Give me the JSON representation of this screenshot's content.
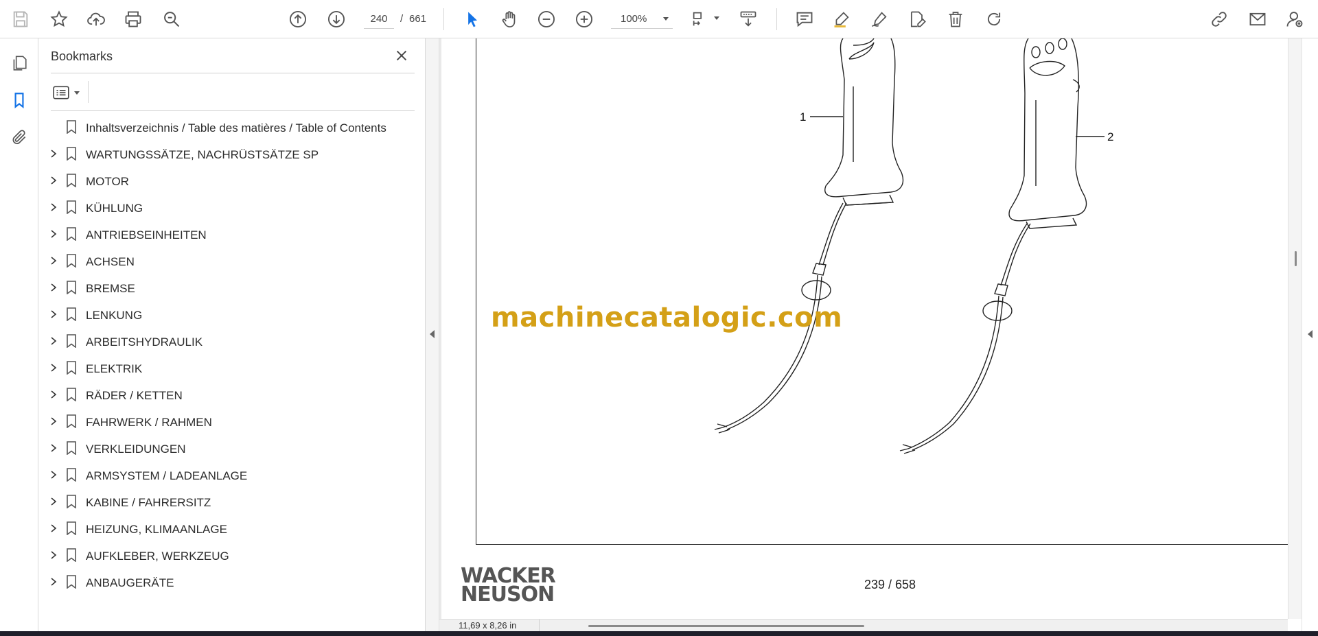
{
  "toolbar": {
    "current_page": "240",
    "page_separator": "/",
    "total_pages": "661",
    "zoom": "100%",
    "icons": [
      "save-icon",
      "star-icon",
      "upload-cloud-icon",
      "print-icon",
      "find-icon",
      "prev-page-icon",
      "next-page-icon",
      "select-arrow-icon",
      "hand-icon",
      "zoom-out-icon",
      "zoom-in-icon",
      "page-fit-icon",
      "scroll-mode-icon",
      "comment-icon",
      "highlight-icon",
      "draw-icon",
      "fill-sign-icon",
      "delete-icon",
      "redo-icon",
      "share-link-icon",
      "email-icon",
      "account-icon"
    ],
    "accent_color": "#1473e6"
  },
  "bookmarks_panel": {
    "title": "Bookmarks",
    "items": [
      {
        "label": "Inhaltsverzeichnis / Table des matières / Table of Contents",
        "expandable": false
      },
      {
        "label": "WARTUNGSSÄTZE, NACHRÜSTSÄTZE SP",
        "expandable": true
      },
      {
        "label": "MOTOR",
        "expandable": true
      },
      {
        "label": "KÜHLUNG",
        "expandable": true
      },
      {
        "label": "ANTRIEBSEINHEITEN",
        "expandable": true
      },
      {
        "label": "ACHSEN",
        "expandable": true
      },
      {
        "label": "BREMSE",
        "expandable": true
      },
      {
        "label": "LENKUNG",
        "expandable": true
      },
      {
        "label": "ARBEITSHYDRAULIK",
        "expandable": true
      },
      {
        "label": "ELEKTRIK",
        "expandable": true
      },
      {
        "label": "RÄDER / KETTEN",
        "expandable": true
      },
      {
        "label": "FAHRWERK / RAHMEN",
        "expandable": true
      },
      {
        "label": "VERKLEIDUNGEN",
        "expandable": true
      },
      {
        "label": "ARMSYSTEM / LADEANLAGE",
        "expandable": true
      },
      {
        "label": "KABINE / FAHRERSITZ",
        "expandable": true
      },
      {
        "label": "HEIZUNG, KLIMAANLAGE",
        "expandable": true
      },
      {
        "label": "AUFKLEBER, WERKZEUG",
        "expandable": true
      },
      {
        "label": "ANBAUGERÄTE",
        "expandable": true
      }
    ]
  },
  "document": {
    "callout_1": "1",
    "callout_2": "2",
    "watermark": "machinecatalogic.com",
    "watermark_color": "#d4a017",
    "logo_line1": "WACKER",
    "logo_line2": "NEUSON",
    "page_number": "239 / 658",
    "page_size": "11,69 x 8,26 in"
  }
}
